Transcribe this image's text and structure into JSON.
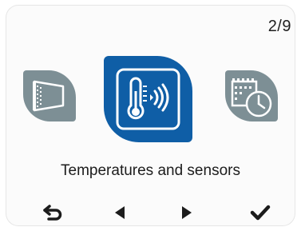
{
  "header": {
    "page_indicator": "2/9"
  },
  "carousel": {
    "items": [
      {
        "icon": "heater-panel-icon",
        "active": false
      },
      {
        "icon": "thermometer-sensor-icon",
        "active": true
      },
      {
        "icon": "calendar-clock-icon",
        "active": false
      }
    ],
    "selected_label": "Temperatures and sensors"
  },
  "nav": {
    "icons": [
      "back-icon",
      "left-arrow-icon",
      "right-arrow-icon",
      "checkmark-icon"
    ]
  },
  "colors": {
    "active_tile": "#0f5ea6",
    "inactive_tile": "#7d8f95",
    "text": "#1c1c1c"
  }
}
